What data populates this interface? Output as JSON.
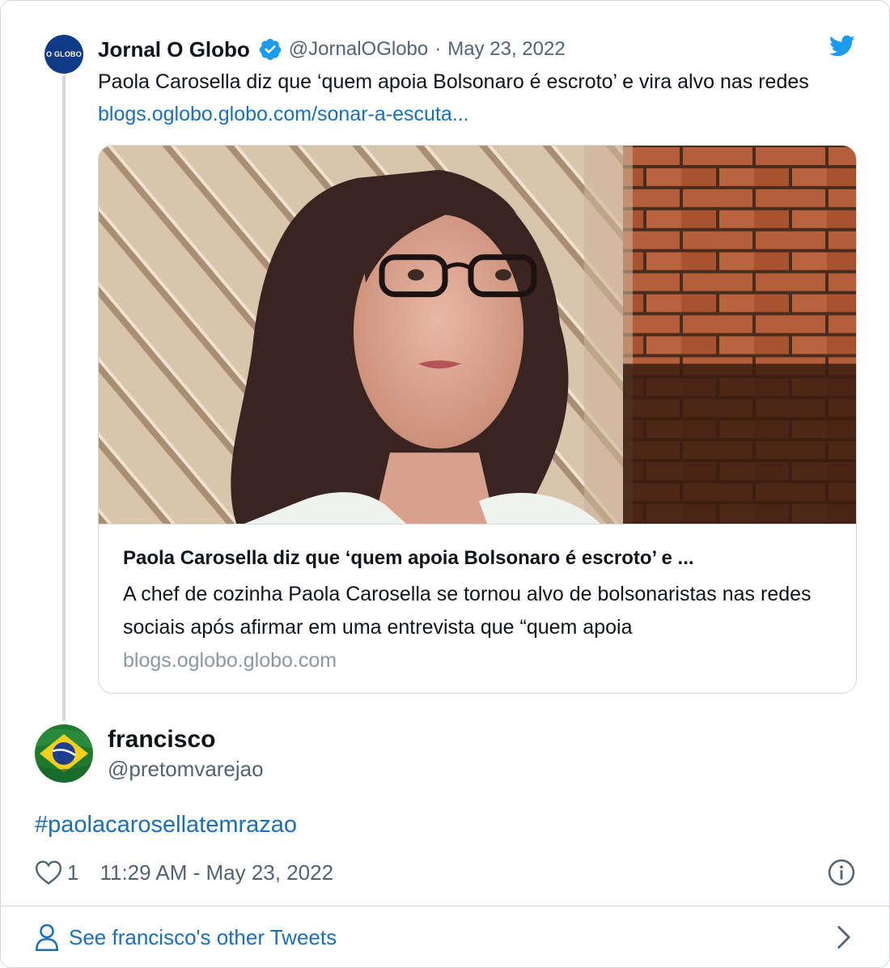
{
  "parent_tweet": {
    "avatar_text": "O GLOBO",
    "author_name": "Jornal O Globo",
    "handle": "@JornalOGlobo",
    "separator": "·",
    "date": "May 23, 2022",
    "text": "Paola Carosella diz que ‘quem apoia Bolsonaro é escroto’ e vira alvo nas redes ",
    "link": "blogs.oglobo.globo.com/sonar-a-escuta...",
    "card": {
      "title": "Paola Carosella diz que ‘quem apoia Bolsonaro é escroto’ e ...",
      "description": "A chef de cozinha Paola Carosella se tornou alvo de bolsonaristas nas redes sociais após afirmar em uma entrevista que “quem apoia",
      "domain": "blogs.oglobo.globo.com"
    }
  },
  "reply_tweet": {
    "author_name": "francisco",
    "handle": "@pretomvarejao",
    "hashtag": "#paolacarosellatemrazao",
    "like_count": "1",
    "timestamp": "11:29 AM - May 23, 2022"
  },
  "footer": {
    "link_text": "See francisco's other Tweets"
  },
  "colors": {
    "link": "#1b6fb8",
    "muted": "#536471",
    "border": "#cfd9de",
    "verified": "#1d9bf0",
    "twitter_blue": "#1d9bf0"
  },
  "icons": [
    "verified-badge-icon",
    "twitter-bird-icon",
    "heart-icon",
    "info-icon",
    "user-icon",
    "chevron-right-icon"
  ]
}
